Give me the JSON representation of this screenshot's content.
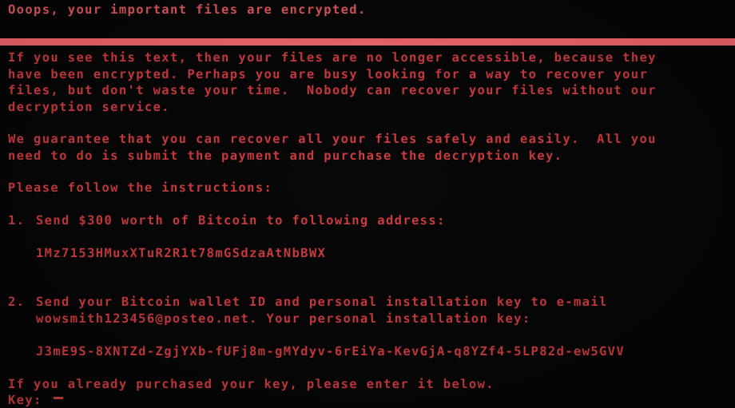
{
  "screen": {
    "background_color": "#050505",
    "text_color": "#cf3a3d",
    "headline_color": "#e2575c",
    "divider_color": "#f5656d"
  },
  "headline": "Ooops, your important files are encrypted.",
  "paragraphs": {
    "intro": [
      "If you see this text, then your files are no longer accessible, because they",
      "have been encrypted. Perhaps you are busy looking for a way to recover your",
      "files, but don't waste your time.  Nobody can recover your files without our",
      "decryption service."
    ],
    "guarantee": [
      "We guarantee that you can recover all your files safely and easily.  All you",
      "need to do is submit the payment and purchase the decryption key."
    ],
    "instructions_header": "Please follow the instructions:"
  },
  "steps": [
    {
      "number": "1.",
      "text": "Send $300 worth of Bitcoin to following address:",
      "value": "1Mz7153HMuxXTuR2R1t78mGSdzaAtNbBWX",
      "amount": "$300",
      "currency": "Bitcoin"
    },
    {
      "number": "2.",
      "text_line_1": "Send your Bitcoin wallet ID and personal installation key to e-mail",
      "text_line_2": "wowsmith123456@posteo.net. Your personal installation key:",
      "email": "wowsmith123456@posteo.net",
      "value": "J3mE9S-8XNTZd-ZgjYXb-fUFj8m-gMYdyv-6rEiYa-KevGjA-q8YZf4-5LP82d-ew5GVV"
    }
  ],
  "prompt": {
    "instruction": "If you already purchased your key, please enter it below.",
    "label": "Key:",
    "value": "",
    "cursor": "_"
  }
}
